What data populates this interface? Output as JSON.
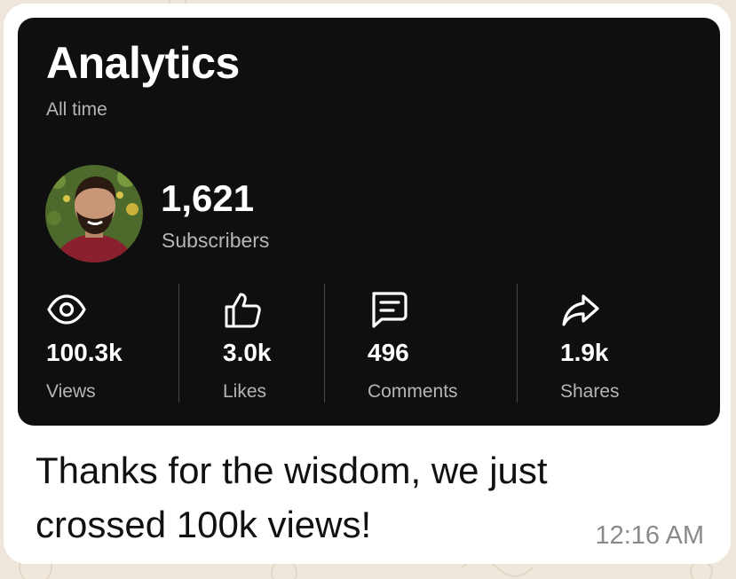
{
  "analytics": {
    "title": "Analytics",
    "period": "All time",
    "subscribers": {
      "count": "1,621",
      "label": "Subscribers"
    },
    "stats": [
      {
        "icon": "eye-icon",
        "value": "100.3k",
        "label": "Views"
      },
      {
        "icon": "thumbs-up-icon",
        "value": "3.0k",
        "label": "Likes"
      },
      {
        "icon": "comment-icon",
        "value": "496",
        "label": "Comments"
      },
      {
        "icon": "share-arrow-icon",
        "value": "1.9k",
        "label": "Shares"
      }
    ]
  },
  "message": {
    "text": "Thanks for the wisdom, we just crossed 100k views!",
    "time": "12:16 AM"
  },
  "colors": {
    "wallpaper": "#efe7dc",
    "bubble": "#ffffff",
    "card": "#0f0f0f",
    "secondary_text": "#b5b5b5",
    "timestamp": "#8a8a8a"
  }
}
